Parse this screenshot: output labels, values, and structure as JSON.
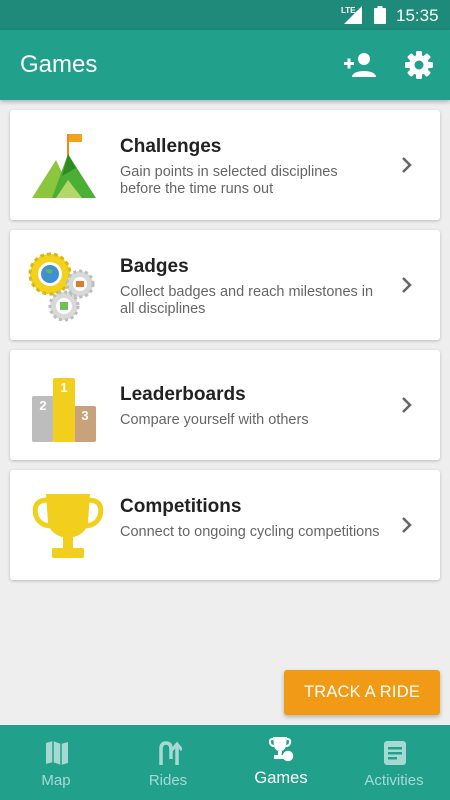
{
  "status_bar": {
    "network": "LTE",
    "time": "15:35"
  },
  "app_bar": {
    "title": "Games",
    "add_friend_icon": "person-add-icon",
    "settings_icon": "gear-icon"
  },
  "cards": [
    {
      "title": "Challenges",
      "description": "Gain points in selected disciplines before the time runs out",
      "icon": "mountain-flag-icon"
    },
    {
      "title": "Badges",
      "description": "Collect badges and reach milestones in all disciplines",
      "icon": "badges-gears-icon"
    },
    {
      "title": "Leaderboards",
      "description": "Compare yourself with others",
      "icon": "podium-icon",
      "podium_labels": [
        "2",
        "1",
        "3"
      ]
    },
    {
      "title": "Competitions",
      "description": "Connect to ongoing cycling competitions",
      "icon": "trophy-icon"
    }
  ],
  "fab": {
    "label": "TRACK A RIDE"
  },
  "bottom_nav": [
    {
      "label": "Map",
      "icon": "map-icon",
      "active": false
    },
    {
      "label": "Rides",
      "icon": "rides-icon",
      "active": false
    },
    {
      "label": "Games",
      "icon": "games-icon",
      "active": true
    },
    {
      "label": "Activities",
      "icon": "activities-icon",
      "active": false
    }
  ],
  "colors": {
    "status_bar": "#1e8a7a",
    "primary": "#21a18c",
    "accent": "#f09a16",
    "background": "#eeeeee"
  }
}
